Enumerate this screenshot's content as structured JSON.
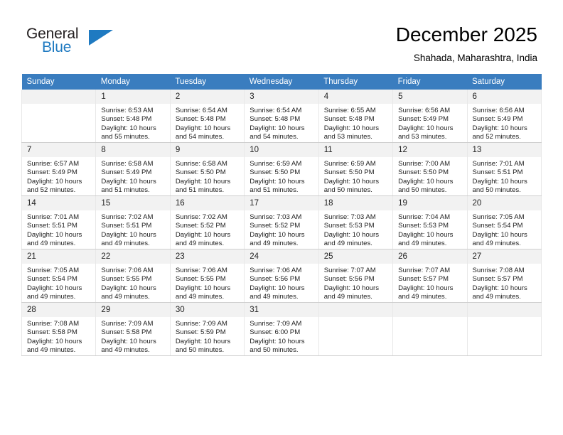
{
  "brand": {
    "name_top": "General",
    "name_bottom": "Blue",
    "logo_icon": "triangle-logo-icon",
    "accent_color": "#1f7ac1"
  },
  "header": {
    "title": "December 2025",
    "location": "Shahada, Maharashtra, India"
  },
  "calendar": {
    "header_bg": "#3a7dbf",
    "daynum_bg": "#f2f2f2",
    "weekday_headers": [
      "Sunday",
      "Monday",
      "Tuesday",
      "Wednesday",
      "Thursday",
      "Friday",
      "Saturday"
    ],
    "weeks": [
      [
        {
          "day": "",
          "sunrise": "",
          "sunset": "",
          "daylight_line1": "",
          "daylight_line2": ""
        },
        {
          "day": "1",
          "sunrise": "Sunrise: 6:53 AM",
          "sunset": "Sunset: 5:48 PM",
          "daylight_line1": "Daylight: 10 hours",
          "daylight_line2": "and 55 minutes."
        },
        {
          "day": "2",
          "sunrise": "Sunrise: 6:54 AM",
          "sunset": "Sunset: 5:48 PM",
          "daylight_line1": "Daylight: 10 hours",
          "daylight_line2": "and 54 minutes."
        },
        {
          "day": "3",
          "sunrise": "Sunrise: 6:54 AM",
          "sunset": "Sunset: 5:48 PM",
          "daylight_line1": "Daylight: 10 hours",
          "daylight_line2": "and 54 minutes."
        },
        {
          "day": "4",
          "sunrise": "Sunrise: 6:55 AM",
          "sunset": "Sunset: 5:48 PM",
          "daylight_line1": "Daylight: 10 hours",
          "daylight_line2": "and 53 minutes."
        },
        {
          "day": "5",
          "sunrise": "Sunrise: 6:56 AM",
          "sunset": "Sunset: 5:49 PM",
          "daylight_line1": "Daylight: 10 hours",
          "daylight_line2": "and 53 minutes."
        },
        {
          "day": "6",
          "sunrise": "Sunrise: 6:56 AM",
          "sunset": "Sunset: 5:49 PM",
          "daylight_line1": "Daylight: 10 hours",
          "daylight_line2": "and 52 minutes."
        }
      ],
      [
        {
          "day": "7",
          "sunrise": "Sunrise: 6:57 AM",
          "sunset": "Sunset: 5:49 PM",
          "daylight_line1": "Daylight: 10 hours",
          "daylight_line2": "and 52 minutes."
        },
        {
          "day": "8",
          "sunrise": "Sunrise: 6:58 AM",
          "sunset": "Sunset: 5:49 PM",
          "daylight_line1": "Daylight: 10 hours",
          "daylight_line2": "and 51 minutes."
        },
        {
          "day": "9",
          "sunrise": "Sunrise: 6:58 AM",
          "sunset": "Sunset: 5:50 PM",
          "daylight_line1": "Daylight: 10 hours",
          "daylight_line2": "and 51 minutes."
        },
        {
          "day": "10",
          "sunrise": "Sunrise: 6:59 AM",
          "sunset": "Sunset: 5:50 PM",
          "daylight_line1": "Daylight: 10 hours",
          "daylight_line2": "and 51 minutes."
        },
        {
          "day": "11",
          "sunrise": "Sunrise: 6:59 AM",
          "sunset": "Sunset: 5:50 PM",
          "daylight_line1": "Daylight: 10 hours",
          "daylight_line2": "and 50 minutes."
        },
        {
          "day": "12",
          "sunrise": "Sunrise: 7:00 AM",
          "sunset": "Sunset: 5:50 PM",
          "daylight_line1": "Daylight: 10 hours",
          "daylight_line2": "and 50 minutes."
        },
        {
          "day": "13",
          "sunrise": "Sunrise: 7:01 AM",
          "sunset": "Sunset: 5:51 PM",
          "daylight_line1": "Daylight: 10 hours",
          "daylight_line2": "and 50 minutes."
        }
      ],
      [
        {
          "day": "14",
          "sunrise": "Sunrise: 7:01 AM",
          "sunset": "Sunset: 5:51 PM",
          "daylight_line1": "Daylight: 10 hours",
          "daylight_line2": "and 49 minutes."
        },
        {
          "day": "15",
          "sunrise": "Sunrise: 7:02 AM",
          "sunset": "Sunset: 5:51 PM",
          "daylight_line1": "Daylight: 10 hours",
          "daylight_line2": "and 49 minutes."
        },
        {
          "day": "16",
          "sunrise": "Sunrise: 7:02 AM",
          "sunset": "Sunset: 5:52 PM",
          "daylight_line1": "Daylight: 10 hours",
          "daylight_line2": "and 49 minutes."
        },
        {
          "day": "17",
          "sunrise": "Sunrise: 7:03 AM",
          "sunset": "Sunset: 5:52 PM",
          "daylight_line1": "Daylight: 10 hours",
          "daylight_line2": "and 49 minutes."
        },
        {
          "day": "18",
          "sunrise": "Sunrise: 7:03 AM",
          "sunset": "Sunset: 5:53 PM",
          "daylight_line1": "Daylight: 10 hours",
          "daylight_line2": "and 49 minutes."
        },
        {
          "day": "19",
          "sunrise": "Sunrise: 7:04 AM",
          "sunset": "Sunset: 5:53 PM",
          "daylight_line1": "Daylight: 10 hours",
          "daylight_line2": "and 49 minutes."
        },
        {
          "day": "20",
          "sunrise": "Sunrise: 7:05 AM",
          "sunset": "Sunset: 5:54 PM",
          "daylight_line1": "Daylight: 10 hours",
          "daylight_line2": "and 49 minutes."
        }
      ],
      [
        {
          "day": "21",
          "sunrise": "Sunrise: 7:05 AM",
          "sunset": "Sunset: 5:54 PM",
          "daylight_line1": "Daylight: 10 hours",
          "daylight_line2": "and 49 minutes."
        },
        {
          "day": "22",
          "sunrise": "Sunrise: 7:06 AM",
          "sunset": "Sunset: 5:55 PM",
          "daylight_line1": "Daylight: 10 hours",
          "daylight_line2": "and 49 minutes."
        },
        {
          "day": "23",
          "sunrise": "Sunrise: 7:06 AM",
          "sunset": "Sunset: 5:55 PM",
          "daylight_line1": "Daylight: 10 hours",
          "daylight_line2": "and 49 minutes."
        },
        {
          "day": "24",
          "sunrise": "Sunrise: 7:06 AM",
          "sunset": "Sunset: 5:56 PM",
          "daylight_line1": "Daylight: 10 hours",
          "daylight_line2": "and 49 minutes."
        },
        {
          "day": "25",
          "sunrise": "Sunrise: 7:07 AM",
          "sunset": "Sunset: 5:56 PM",
          "daylight_line1": "Daylight: 10 hours",
          "daylight_line2": "and 49 minutes."
        },
        {
          "day": "26",
          "sunrise": "Sunrise: 7:07 AM",
          "sunset": "Sunset: 5:57 PM",
          "daylight_line1": "Daylight: 10 hours",
          "daylight_line2": "and 49 minutes."
        },
        {
          "day": "27",
          "sunrise": "Sunrise: 7:08 AM",
          "sunset": "Sunset: 5:57 PM",
          "daylight_line1": "Daylight: 10 hours",
          "daylight_line2": "and 49 minutes."
        }
      ],
      [
        {
          "day": "28",
          "sunrise": "Sunrise: 7:08 AM",
          "sunset": "Sunset: 5:58 PM",
          "daylight_line1": "Daylight: 10 hours",
          "daylight_line2": "and 49 minutes."
        },
        {
          "day": "29",
          "sunrise": "Sunrise: 7:09 AM",
          "sunset": "Sunset: 5:58 PM",
          "daylight_line1": "Daylight: 10 hours",
          "daylight_line2": "and 49 minutes."
        },
        {
          "day": "30",
          "sunrise": "Sunrise: 7:09 AM",
          "sunset": "Sunset: 5:59 PM",
          "daylight_line1": "Daylight: 10 hours",
          "daylight_line2": "and 50 minutes."
        },
        {
          "day": "31",
          "sunrise": "Sunrise: 7:09 AM",
          "sunset": "Sunset: 6:00 PM",
          "daylight_line1": "Daylight: 10 hours",
          "daylight_line2": "and 50 minutes."
        },
        {
          "day": "",
          "sunrise": "",
          "sunset": "",
          "daylight_line1": "",
          "daylight_line2": ""
        },
        {
          "day": "",
          "sunrise": "",
          "sunset": "",
          "daylight_line1": "",
          "daylight_line2": ""
        },
        {
          "day": "",
          "sunrise": "",
          "sunset": "",
          "daylight_line1": "",
          "daylight_line2": ""
        }
      ]
    ]
  }
}
